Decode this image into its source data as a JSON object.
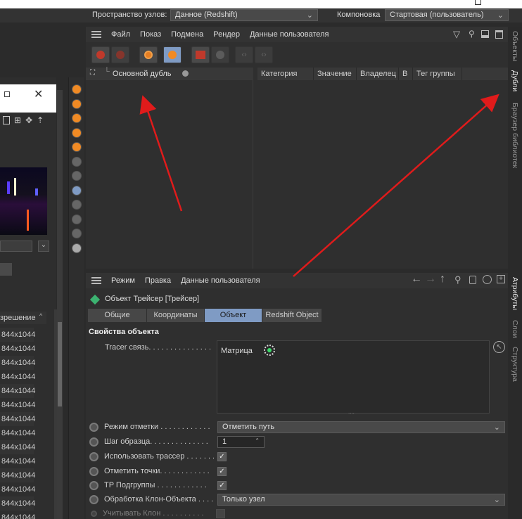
{
  "topbar": {
    "node_space_label": "Пространство узлов:",
    "node_space_value": "Данное (Redshift)",
    "layout_label": "Компоновка",
    "layout_value": "Стартовая (пользователь)"
  },
  "takes_panel": {
    "menu": [
      "Файл",
      "Показ",
      "Подмена",
      "Рендер",
      "Данные пользователя"
    ],
    "main_take_label": "Основной дубль",
    "columns": [
      "Категория",
      "Значение",
      "Владелец",
      "В",
      "Тег группы"
    ]
  },
  "right_tabs_top": [
    "Объекты",
    "Дубли",
    "Браузер библиотек"
  ],
  "right_tabs_bottom": [
    "Атрибуты",
    "Слои",
    "Структура"
  ],
  "attributes": {
    "menu": [
      "Режим",
      "Правка",
      "Данные пользователя"
    ],
    "object_title": "Объект Трейсер [Трейсер]",
    "tabs": [
      "Общие",
      "Координаты",
      "Объект",
      "Redshift Object"
    ],
    "active_tab": "Объект",
    "section_title": "Свойства объекта",
    "tracer_link_label": "Tracer связь. . . . . . . . . . . . . . .",
    "tracer_link_item": "Матрица",
    "params": {
      "trace_mode_label": "Режим отметки . . . . . . . . . . . .",
      "trace_mode_value": "Отметить путь",
      "sample_step_label": "Шаг образца. . . . . . . . . . . . . .",
      "sample_step_value": "1",
      "use_tracer_label": "Использовать трассер . . . . . . .",
      "trace_vertices_label": "Отметить точки. . . . . . . . . . . .",
      "tp_subgroups_label": "TP Подгруппы . . . . . . . . . . . .",
      "clone_handling_label": "Обработка Клон-Объекта . . . .",
      "clone_handling_value": "Только узел",
      "consider_clone_label": "Учитывать Клон . . . . . . . . . ."
    }
  },
  "left_panel": {
    "column_header": "зрешение",
    "resolutions": [
      "844x1044",
      "844x1044",
      "844x1044",
      "844x1044",
      "844x1044",
      "844x1044",
      "844x1044",
      "844x1044",
      "844x1044",
      "844x1044",
      "844x1044",
      "844x1044",
      "844x1044",
      "844x1044"
    ]
  },
  "colors": {
    "accent_blue": "#7f9bc4",
    "arrow_red": "#e01b1b",
    "panel_bg": "#2f2f2f"
  }
}
